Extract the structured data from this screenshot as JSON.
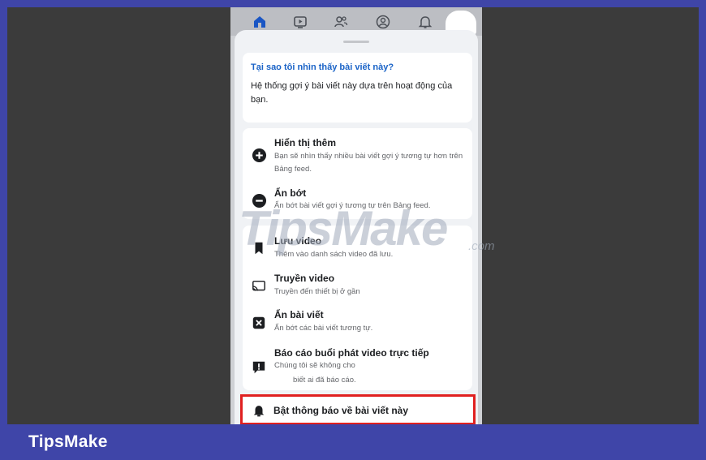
{
  "brand": "TipsMake",
  "watermark": {
    "main": "TipsMake",
    "suffix": ".com"
  },
  "nav": {
    "icons": [
      "home-icon",
      "video-icon",
      "friends-icon",
      "profile-icon",
      "bell-icon"
    ],
    "colors": {
      "active": "#1a56c4",
      "inactive": "#4b4f56"
    }
  },
  "why": {
    "title": "Tại sao tôi nhìn thấy bài viết này?",
    "body": "Hệ thống gợi ý bài viết này dựa trên hoạt động của bạn."
  },
  "feed_options": [
    {
      "title": "Hiển thị thêm",
      "subtitle": "Bạn sẽ nhìn thấy nhiều bài viết gợi ý tương tự hơn trên Bảng feed.",
      "icon": "plus-circle-icon"
    },
    {
      "title": "Ẩn bớt",
      "subtitle": "Ẩn bớt bài viết gợi ý tương tự trên Bảng feed.",
      "icon": "minus-circle-icon"
    }
  ],
  "actions": [
    {
      "title": "Lưu video",
      "subtitle": "Thêm vào danh sách video đã lưu.",
      "icon": "bookmark-icon"
    },
    {
      "title": "Truyền video",
      "subtitle": "Truyền đến thiết bị ở gần",
      "icon": "cast-icon"
    },
    {
      "title": "Ẩn bài viết",
      "subtitle": "Ẩn bớt các bài viết tương tự.",
      "icon": "close-box-icon"
    },
    {
      "title": "Báo cáo buổi phát video trực tiếp",
      "subtitle_line1": "Chúng tôi sẽ không cho",
      "subtitle_line2": "biết ai đã báo cáo.",
      "icon": "report-icon"
    }
  ],
  "highlight": {
    "title": "Bật thông báo về bài viết này",
    "icon": "bell-filled-icon",
    "border_color": "#e02020"
  },
  "colors": {
    "frame": "#3f45a8",
    "link": "#1a63c7"
  }
}
